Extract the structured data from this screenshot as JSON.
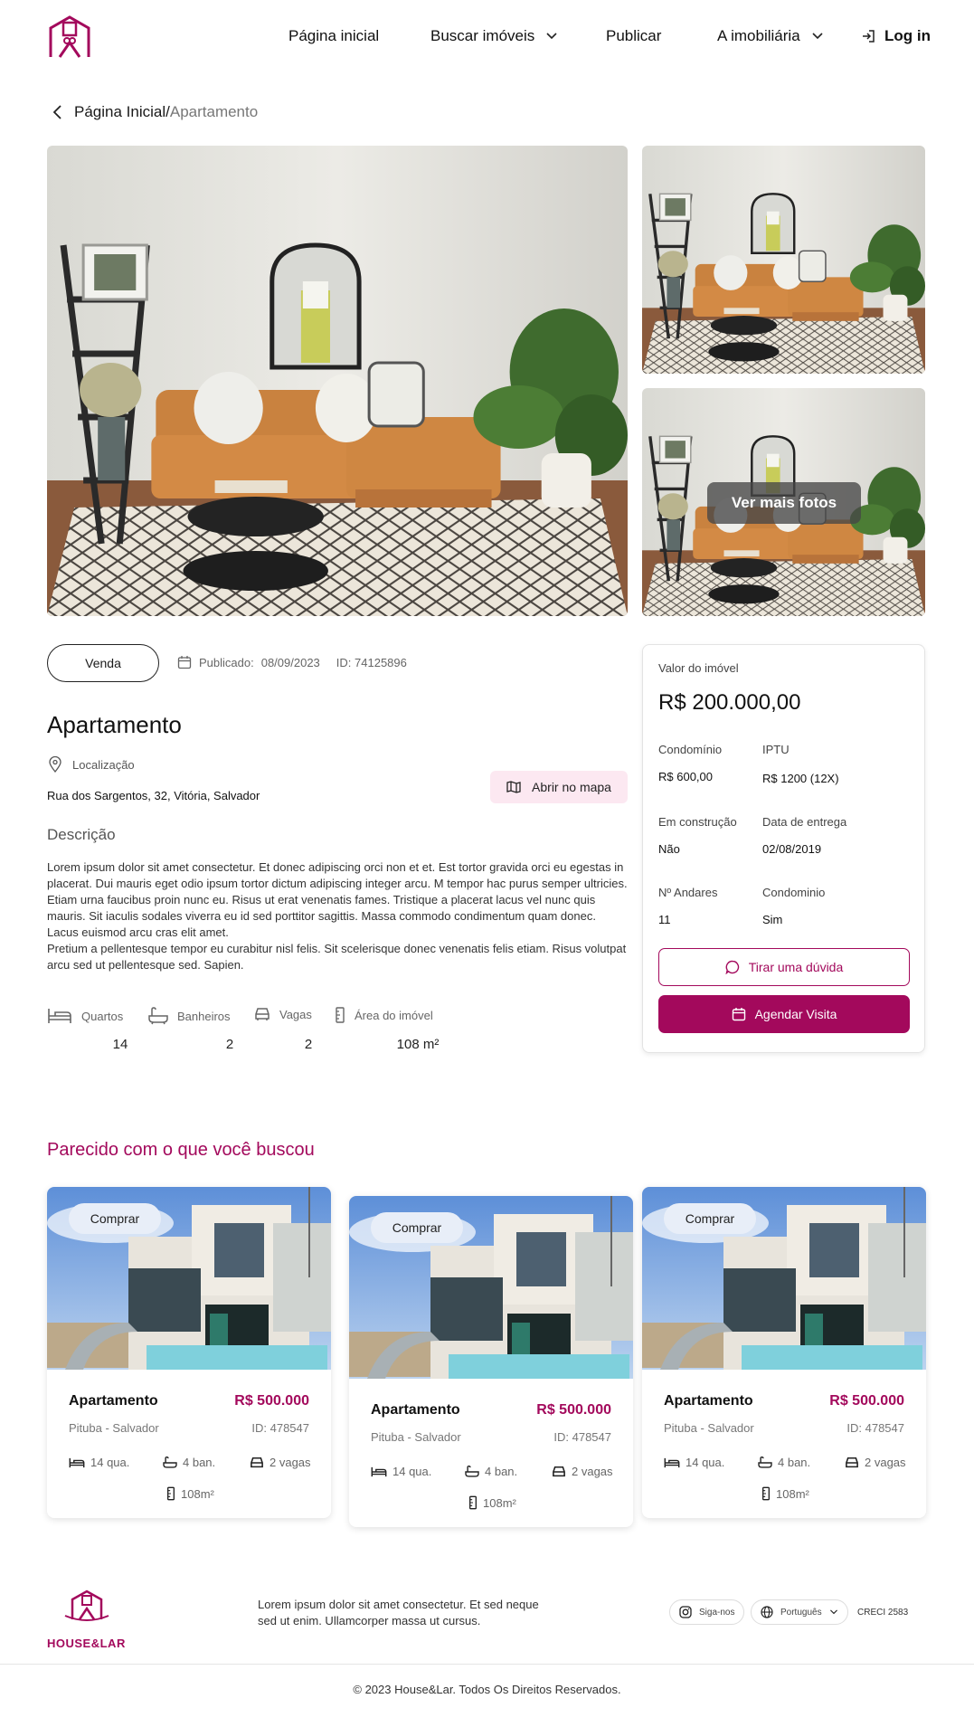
{
  "header": {
    "nav": [
      "Página inicial",
      "Buscar imóveis",
      "Publicar",
      "A imobiliária"
    ],
    "login": "Log in"
  },
  "breadcrumb": {
    "home": "Página Inicial",
    "sep": "/",
    "current": "Apartamento"
  },
  "gallery": {
    "more_photos": "Ver mais fotos"
  },
  "listing": {
    "type": "Venda",
    "published_label": "Publicado:",
    "published_date": "08/09/2023",
    "id": "ID: 74125896",
    "title": "Apartamento",
    "location_label": "Localização",
    "address": "Rua dos Sargentos, 32, Vitória, Salvador",
    "map_button": "Abrir no mapa",
    "description_title": "Descrição",
    "description_1": "Lorem ipsum dolor sit amet consectetur. Et donec adipiscing orci non et et. Est tortor gravida orci eu egestas in placerat. Dui mauris eget odio ipsum tortor dictum adipiscing integer arcu. M tempor hac purus semper ultricies. Etiam urna faucibus proin nunc eu. Risus ut erat venenatis fames. Tristique a placerat lacus vel nunc quis mauris. Sit iaculis sodales viverra eu id sed porttitor sagittis. Massa commodo condimentum quam donec. Lacus euismod arcu cras elit amet.",
    "description_2": "Pretium a pellentesque tempor eu curabitur nisl felis. Sit scelerisque donec venenatis felis etiam. Risus volutpat arcu sed ut pellentesque sed. Sapien.",
    "features": [
      {
        "label": "Quartos",
        "value": "14",
        "icon": "bed-icon"
      },
      {
        "label": "Banheiros",
        "value": "2",
        "icon": "bathtub-icon"
      },
      {
        "label": "Vagas",
        "value": "2",
        "icon": "car-icon"
      },
      {
        "label": "Área do imóvel",
        "value": "108 m²",
        "icon": "ruler-icon"
      }
    ]
  },
  "price_card": {
    "value_label": "Valor do imóvel",
    "price": "R$ 200.000,00",
    "condo_label": "Condomínio",
    "condo_value": "R$ 600,00",
    "iptu_label": "IPTU",
    "iptu_value": "R$ 1200 (12X)",
    "construction_label": "Em construção",
    "construction_value": "Não",
    "delivery_label": "Data de entrega",
    "delivery_value": "02/08/2019",
    "floors_label": "Nº Andares",
    "floors_value": "11",
    "condo2_label": "Condominio",
    "condo2_value": "Sim",
    "question_button": "Tirar uma dúvida",
    "schedule_button": "Agendar Visita"
  },
  "similar": {
    "title": "Parecido com o que você buscou",
    "cards": [
      {
        "tag": "Comprar",
        "title": "Apartamento",
        "price": "R$ 500.000",
        "location": "Pituba - Salvador",
        "id": "ID: 478547",
        "rooms": "14 qua.",
        "baths": "4 ban.",
        "parking": "2 vagas",
        "area": "108m²"
      },
      {
        "tag": "Comprar",
        "title": "Apartamento",
        "price": "R$ 500.000",
        "location": "Pituba - Salvador",
        "id": "ID: 478547",
        "rooms": "14 qua.",
        "baths": "4 ban.",
        "parking": "2 vagas",
        "area": "108m²"
      },
      {
        "tag": "Comprar",
        "title": "Apartamento",
        "price": "R$ 500.000",
        "location": "Pituba - Salvador",
        "id": "ID: 478547",
        "rooms": "14 qua.",
        "baths": "4 ban.",
        "parking": "2 vagas",
        "area": "108m²"
      }
    ]
  },
  "footer": {
    "logo_text": "HOUSE&LAR",
    "text": "Lorem ipsum dolor sit amet consectetur. Et sed neque sed ut enim. Ullamcorper massa ut cursus.",
    "social": "Siga-nos",
    "language": "Português",
    "creci": "CRECI 2583",
    "copyright": "© 2023 House&Lar. Todos Os Direitos Reservados."
  },
  "colors": {
    "brand": "#a3095c",
    "brand_light": "#fce8f1"
  }
}
